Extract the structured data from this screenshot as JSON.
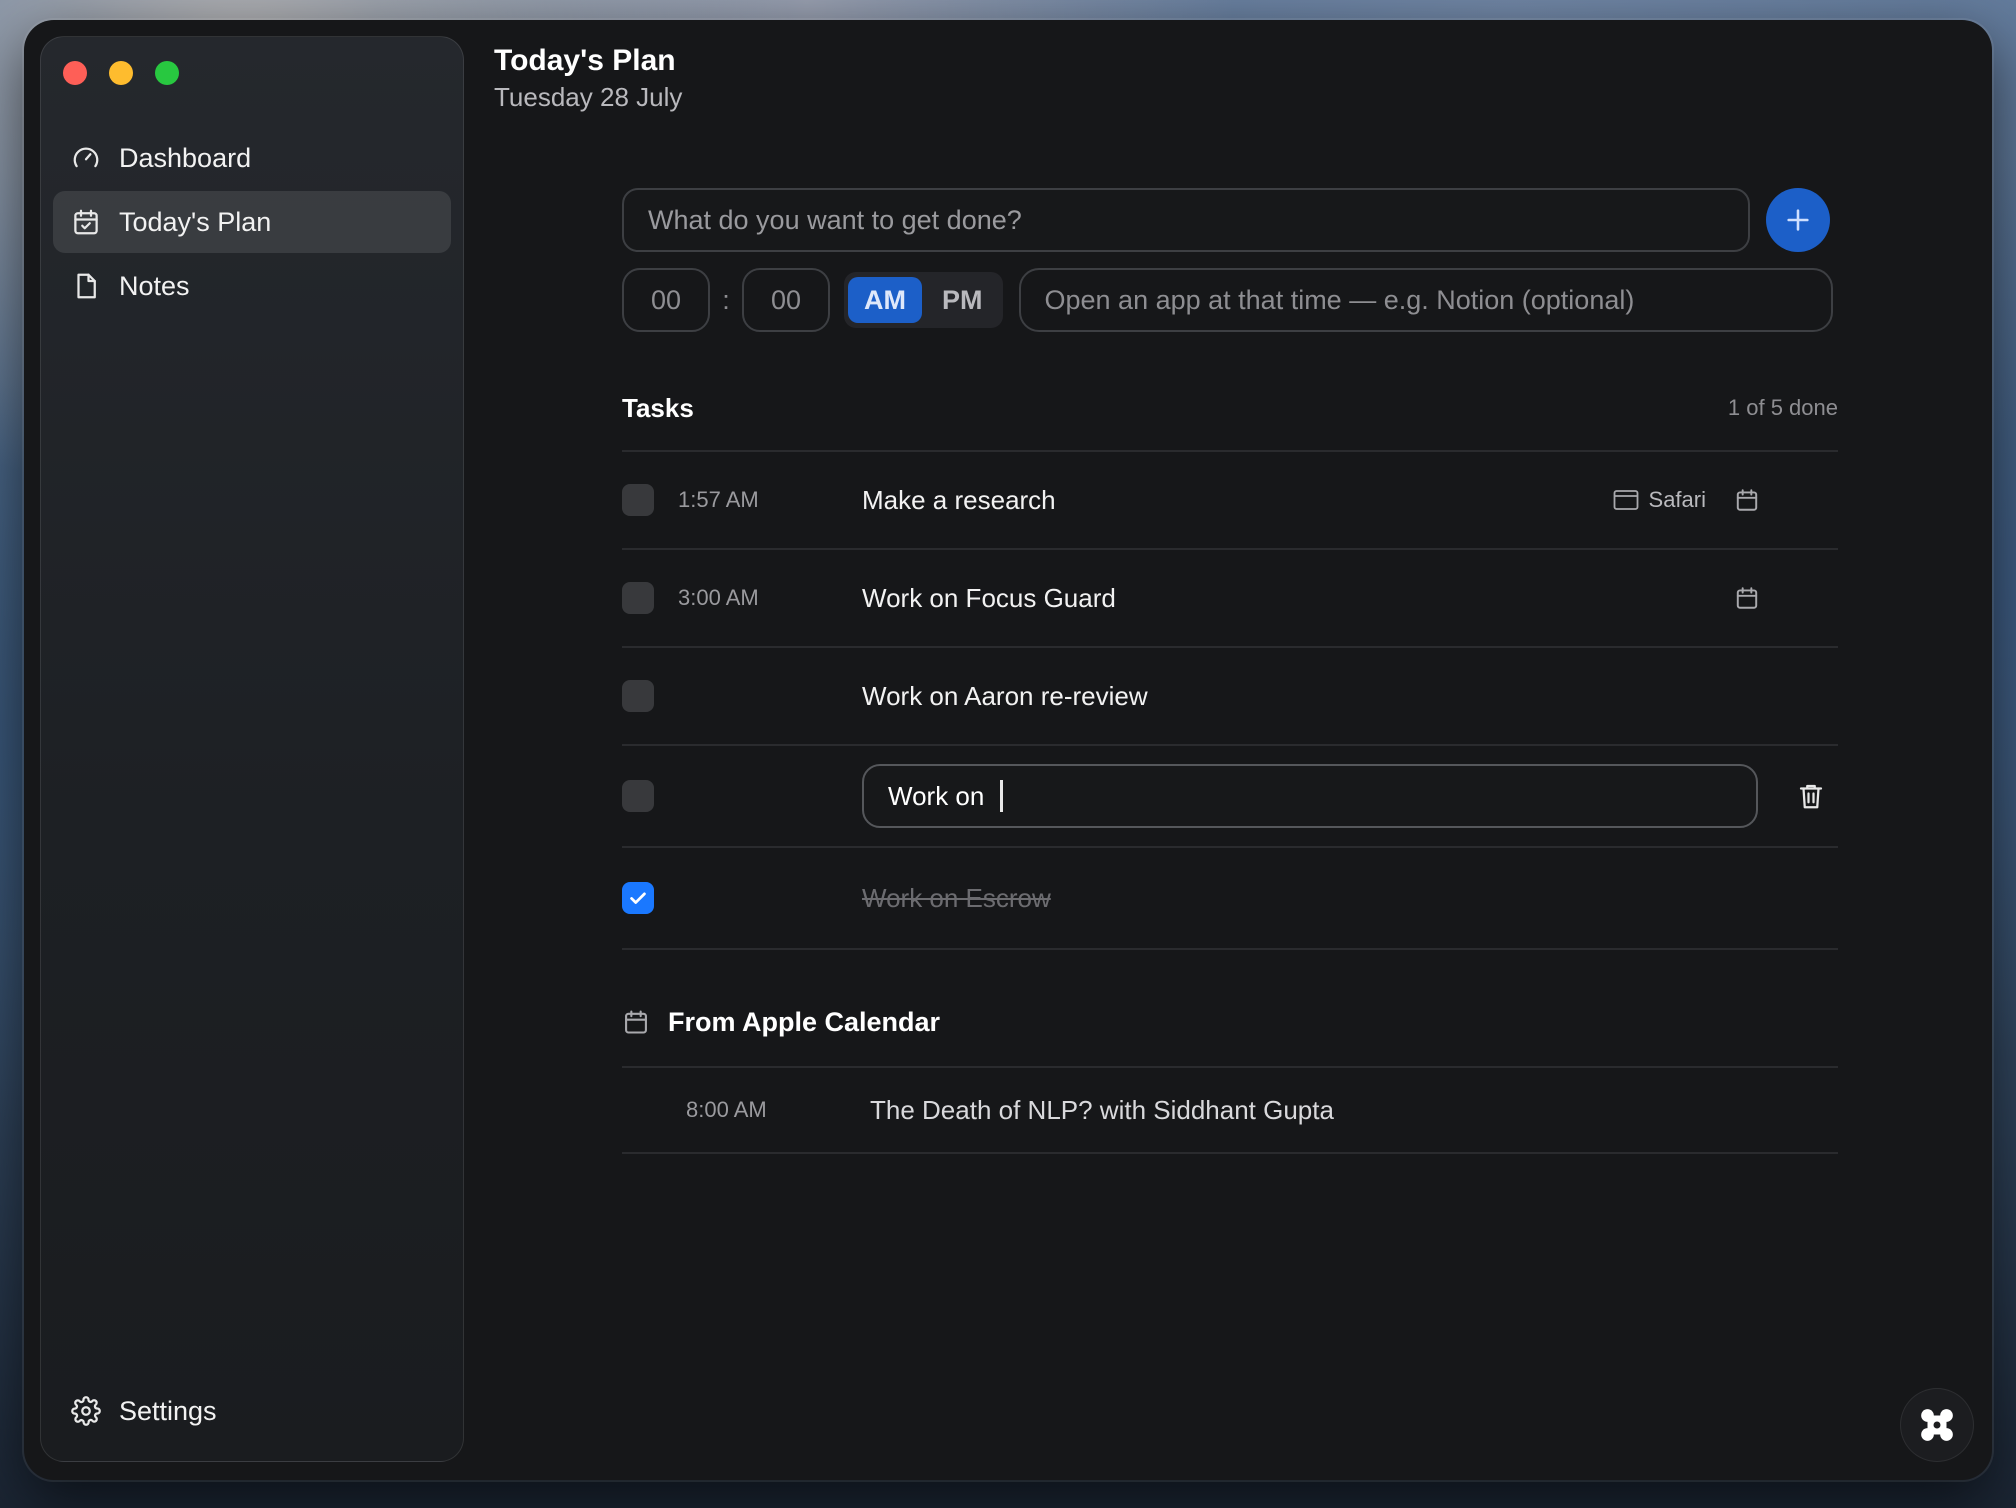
{
  "sidebar": {
    "items": [
      {
        "label": "Dashboard",
        "icon": "gauge-icon"
      },
      {
        "label": "Today's Plan",
        "icon": "calendar-check-icon",
        "active": true
      },
      {
        "label": "Notes",
        "icon": "document-icon"
      }
    ],
    "settings_label": "Settings"
  },
  "header": {
    "title": "Today's Plan",
    "date": "Tuesday 28 July"
  },
  "new_task": {
    "placeholder": "What do you want to get done?",
    "hour_placeholder": "00",
    "minute_placeholder": "00",
    "separator": ":",
    "am_label": "AM",
    "pm_label": "PM",
    "selected_period": "AM",
    "app_placeholder": "Open an app at that time — e.g. Notion (optional)"
  },
  "tasks": {
    "title": "Tasks",
    "count_label": "1 of 5 done",
    "items": [
      {
        "time": "1:57 AM",
        "text": "Make a research",
        "app": "Safari",
        "done": false
      },
      {
        "time": "3:00 AM",
        "text": "Work on Focus Guard",
        "done": false
      },
      {
        "text": "Work on Aaron re-review",
        "done": false
      },
      {
        "editing_value": "Work on ",
        "done": false
      },
      {
        "text": "Work on Escrow",
        "done": true
      }
    ]
  },
  "calendar": {
    "title": "From Apple Calendar",
    "events": [
      {
        "time": "8:00 AM",
        "title": "The Death of NLP? with Siddhant Gupta"
      }
    ]
  },
  "colors": {
    "accent": "#1c5fc8",
    "checkbox_checked": "#1a78ff",
    "window_bg": "#161719"
  }
}
